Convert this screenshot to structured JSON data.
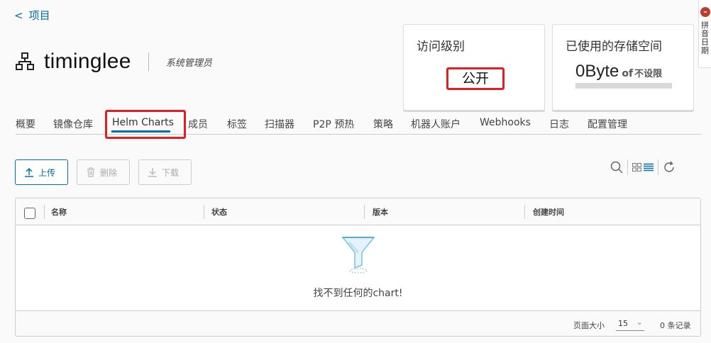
{
  "nav": {
    "back_label": "项目"
  },
  "project": {
    "name": "timinglee",
    "role": "系统管理员"
  },
  "cards": {
    "access": {
      "title": "访问级别",
      "value": "公开"
    },
    "storage": {
      "title": "已使用的存储空间",
      "used": "0Byte",
      "of": "of",
      "limit": "不设限"
    }
  },
  "side_widget": {
    "badge": "–",
    "text": "拼音日期"
  },
  "tabs": [
    {
      "label": "概要"
    },
    {
      "label": "镜像仓库"
    },
    {
      "label": "Helm Charts",
      "active": true
    },
    {
      "label": "成员"
    },
    {
      "label": "标签"
    },
    {
      "label": "扫描器"
    },
    {
      "label": "P2P 预热"
    },
    {
      "label": "策略"
    },
    {
      "label": "机器人账户"
    },
    {
      "label": "Webhooks"
    },
    {
      "label": "日志"
    },
    {
      "label": "配置管理"
    }
  ],
  "toolbar": {
    "upload": "上传",
    "delete": "删除",
    "download": "下载"
  },
  "table": {
    "columns": [
      "名称",
      "状态",
      "版本",
      "创建时间"
    ],
    "empty_message": "找不到任何的chart!",
    "page_size_label": "页面大小",
    "page_size": "15",
    "record_count": "0 条记录"
  },
  "colors": {
    "accent": "#0072a3",
    "highlight": "#e02020"
  },
  "icons": {
    "project": "project-org-icon",
    "upload": "upload-icon",
    "delete": "trash-icon",
    "download": "download-icon",
    "search": "search-icon",
    "view": "grid-list-toggle-icon",
    "refresh": "refresh-icon",
    "empty": "funnel-icon"
  }
}
